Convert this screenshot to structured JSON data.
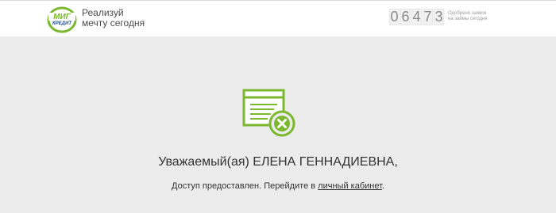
{
  "header": {
    "logo": {
      "line1": "МИГ",
      "line2": "КРЕДИТ"
    },
    "slogan": {
      "line1": "Реализуй",
      "line2": "мечту сегодня"
    },
    "counter": {
      "digits": [
        "0",
        "6",
        "4",
        "7",
        "3"
      ],
      "caption_line1": "Одобрено заявок",
      "caption_line2": "на займы сегодня"
    }
  },
  "main": {
    "icon": "document-rejected-icon",
    "greeting": "Уважаемый(ая) ЕЛЕНА ГЕННАДИЕВНА,",
    "message_prefix": "Доступ предоставлен. Перейдите в ",
    "link_text": "личный кабинет",
    "message_suffix": "."
  },
  "colors": {
    "accent_green": "#7cb82f",
    "logo_blue": "#1d4f91",
    "background": "#ececec"
  }
}
